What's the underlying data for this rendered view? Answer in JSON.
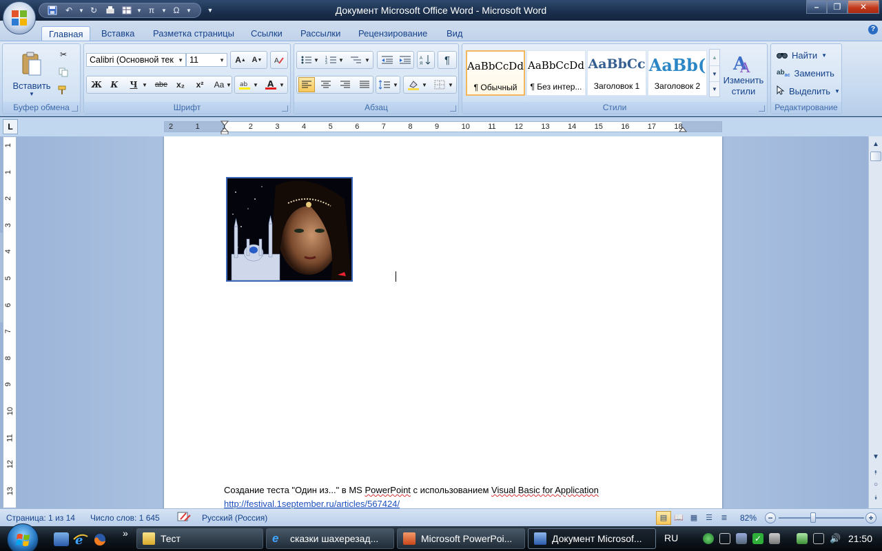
{
  "window": {
    "title": "Документ Microsoft Office Word - Microsoft Word",
    "minimize": "–",
    "maximize": "❐",
    "close": "✕"
  },
  "quick_access": [
    "save-icon",
    "undo-icon",
    "redo-icon",
    "print-preview-icon",
    "table-icon",
    "equation-icon",
    "symbol-icon",
    "customize-icon"
  ],
  "tabs": [
    "Главная",
    "Вставка",
    "Разметка страницы",
    "Ссылки",
    "Рассылки",
    "Рецензирование",
    "Вид"
  ],
  "ribbon": {
    "clipboard": {
      "label": "Буфер обмена",
      "paste": "Вставить"
    },
    "font": {
      "label": "Шрифт",
      "font_name": "Calibri (Основной тек",
      "font_size": "11",
      "bold": "Ж",
      "italic": "К",
      "underline": "Ч",
      "strike": "abe",
      "subscript": "x₂",
      "superscript": "x²",
      "case": "Aa",
      "grow": "A",
      "shrink": "A"
    },
    "paragraph": {
      "label": "Абзац"
    },
    "styles": {
      "label": "Стили",
      "items": [
        {
          "sample": "AaBbCcDd",
          "name": "¶ Обычный"
        },
        {
          "sample": "AaBbCcDd",
          "name": "¶ Без интер..."
        },
        {
          "sample": "AaBbCc",
          "name": "Заголовок 1"
        },
        {
          "sample": "AaBb(",
          "name": "Заголовок 2"
        }
      ],
      "change": "Изменить стили"
    },
    "editing": {
      "label": "Редактирование",
      "find": "Найти",
      "replace": "Заменить",
      "select": "Выделить"
    }
  },
  "ruler": {
    "tab_selector": "L",
    "numbers": [
      "2",
      "1",
      "1",
      "2",
      "3",
      "4",
      "5",
      "6",
      "7",
      "8",
      "9",
      "10",
      "11",
      "12",
      "13",
      "14",
      "15",
      "16",
      "17",
      "18"
    ],
    "vnumbers": [
      "1",
      "1",
      "2",
      "3",
      "4",
      "5",
      "6",
      "7",
      "8",
      "9",
      "10",
      "11",
      "12",
      "13",
      "14"
    ]
  },
  "document": {
    "line1_a": "Создание теста \"Один из...\"  в MS ",
    "line1_b": "PowerPoint",
    "line1_c": " с использованием ",
    "line1_d": "Visual Basic for Application",
    "link": "http://festival.1september.ru/articles/567424/"
  },
  "status": {
    "page": "Страница: 1 из 14",
    "words": "Число слов: 1 645",
    "language": "Русский (Россия)",
    "zoom": "82%",
    "zoom_level": 0.82
  },
  "taskbar": {
    "items": [
      {
        "label": "Тест",
        "icon": "folder-icon"
      },
      {
        "label": "сказки шахерезад...",
        "icon": "internet-explorer-icon"
      },
      {
        "label": "Microsoft PowerPoi...",
        "icon": "powerpoint-icon"
      },
      {
        "label": "Документ Microsof...",
        "icon": "word-icon"
      }
    ],
    "language": "RU",
    "time": "21:50"
  }
}
